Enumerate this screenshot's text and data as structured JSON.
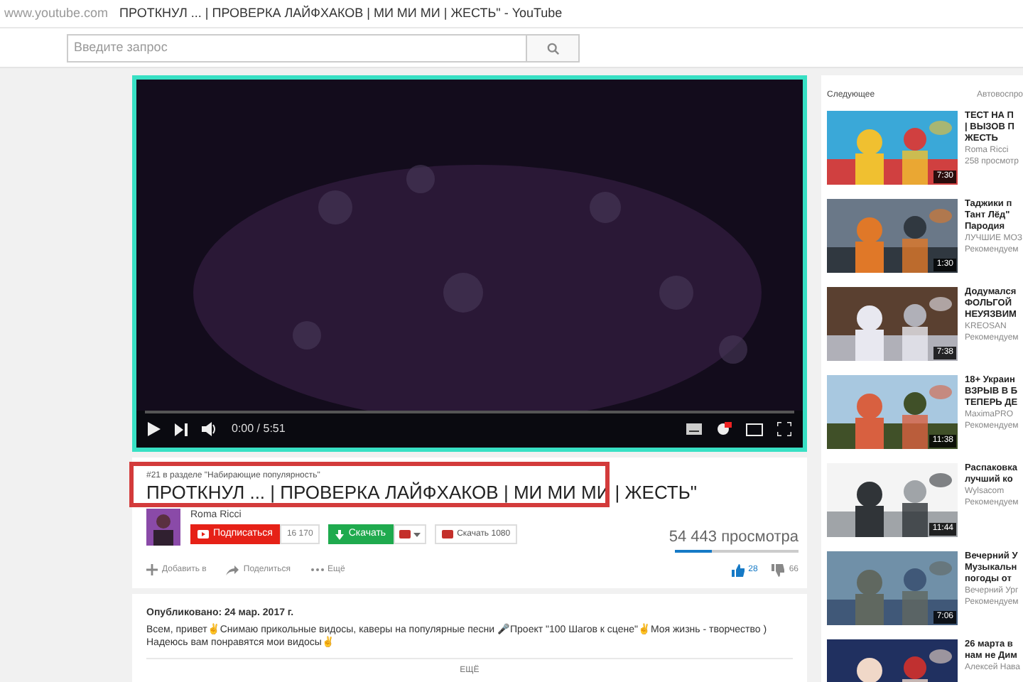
{
  "browser": {
    "url": "www.youtube.com",
    "title": "ПРОТКНУЛ ... | ПРОВЕРКА ЛАЙФХАКОВ | МИ МИ МИ | ЖЕСТЬ\" - YouTube"
  },
  "search": {
    "placeholder": "Введите запрос"
  },
  "player": {
    "time": "0:00 / 5:51"
  },
  "video": {
    "trending": "#21 в разделе \"Набирающие популярность\"",
    "title": "ПРОТКНУЛ ... | ПРОВЕРКА ЛАЙФХАКОВ | МИ МИ МИ | ЖЕСТЬ\"",
    "channel": "Roma Ricci",
    "subscribe": "Подписаться",
    "subscribers": "16 170",
    "download": "Скачать",
    "download_hd": "Скачать 1080",
    "views": "54 443 просмотра",
    "actions": [
      "Добавить в",
      "Поделиться",
      "Ещё"
    ],
    "likes": "28",
    "dislikes": "66"
  },
  "description": {
    "published": "Опубликовано: 24 мар. 2017 г.",
    "text": "Всем, привет✌Снимаю прикольные видосы, каверы на популярные песни 🎤Проект \"100 Шагов к сцене\"✌Моя жизнь - творчество ) Надеюсь вам понравятся мои видосы✌",
    "more": "ЕЩЁ"
  },
  "sidebar": {
    "heading": "Следующее",
    "autoplay": "Автовоспро",
    "items": [
      {
        "title": [
          "ТЕСТ НА П",
          "| ВЫЗОВ П",
          "ЖЕСТЬ"
        ],
        "channel": "Roma Ricci",
        "meta": "258 просмотр",
        "duration": "7:30"
      },
      {
        "title": [
          "Таджики п",
          "Тант Лёд\"",
          "Пародия"
        ],
        "channel": "ЛУЧШИЕ МОЗ",
        "meta": "Рекомендуем",
        "duration": "1:30"
      },
      {
        "title": [
          "Додумался",
          "ФОЛЬГОЙ",
          "НЕУЯЗВИМ"
        ],
        "channel": "KREOSAN",
        "meta": "Рекомендуем",
        "duration": "7:38"
      },
      {
        "title": [
          "18+ Украин",
          "ВЗРЫВ В Б",
          "ТЕПЕРЬ ДЕ"
        ],
        "channel": "MaximaPRO",
        "meta": "Рекомендуем",
        "duration": "11:38"
      },
      {
        "title": [
          "Распаковка",
          "лучший ко"
        ],
        "channel": "Wylsacom",
        "meta": "Рекомендуем",
        "duration": "11:44"
      },
      {
        "title": [
          "Вечерний У",
          "Музыкальн",
          "погоды от"
        ],
        "channel": "Вечерний Ург",
        "meta": "Рекомендуем",
        "duration": "7:06"
      },
      {
        "title": [
          "26 марта в",
          "нам не Дим"
        ],
        "channel": "Алексей Нава"
      }
    ]
  }
}
